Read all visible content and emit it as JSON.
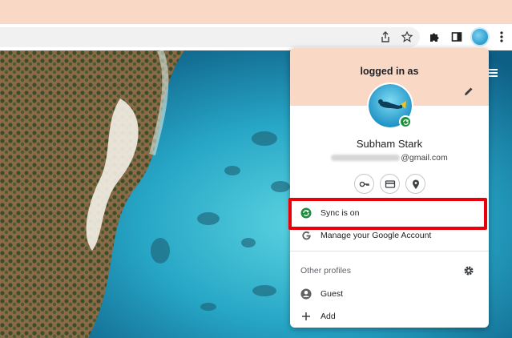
{
  "toolbar": {
    "share_icon": "share-icon",
    "bookmark_icon": "star-icon",
    "extensions_icon": "puzzle-icon",
    "sidepanel_icon": "side-panel-icon",
    "profile_icon": "avatar",
    "more_icon": "kebab-menu-icon"
  },
  "popup": {
    "title": "logged in as",
    "user_name": "Subham Stark",
    "email_domain": "@gmail.com",
    "quick_actions": [
      "key-icon",
      "card-icon",
      "location-icon"
    ],
    "sync_label": "Sync is on",
    "manage_label": "Manage your Google Account",
    "other_profiles_label": "Other profiles",
    "guest_label": "Guest",
    "add_label": "Add"
  },
  "colors": {
    "header_bg": "#f9d8c5",
    "sync_green": "#1e8e3e",
    "highlight_red": "#e8000a"
  }
}
